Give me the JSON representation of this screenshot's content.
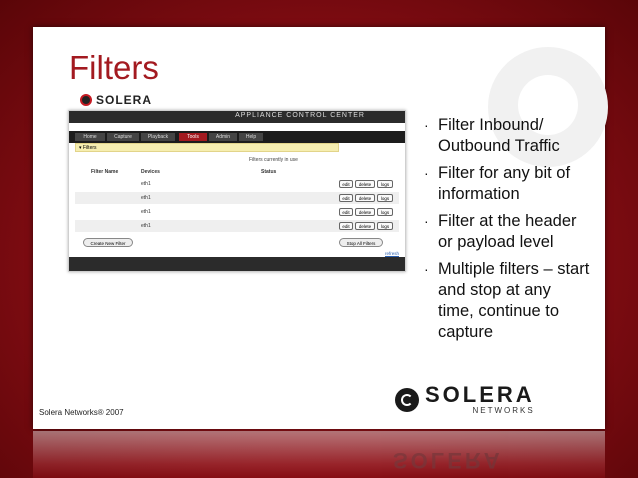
{
  "slide": {
    "title": "Filters",
    "footer": "Solera Networks® 2007",
    "logo_text": "SOLERA",
    "logo_subtext": "NETWORKS",
    "bullets": [
      "Filter Inbound/ Outbound Traffic",
      "Filter for any bit of information",
      "Filter at the header or payload level",
      "Multiple filters – start and stop at any time, continue to capture"
    ],
    "bullet_glyph": "·"
  },
  "screenshot": {
    "app_title": "APPLIANCE CONTROL CENTER",
    "nav_tabs": [
      "Home",
      "Capture",
      "Playback",
      "Tools",
      "Admin",
      "Help"
    ],
    "active_tab": "Tools",
    "breadcrumb": "Filters",
    "summary": "Filters currently in use",
    "columns": [
      "Filter Name",
      "Devices",
      "Status"
    ],
    "rows": [
      {
        "name": "",
        "device": "eth1"
      },
      {
        "name": "",
        "device": "eth1"
      },
      {
        "name": "",
        "device": "eth1"
      },
      {
        "name": "",
        "device": "eth1"
      }
    ],
    "row_buttons": [
      "edit",
      "delete",
      "logs"
    ],
    "create_button": "Create New Filter",
    "stop_button": "Stop All Filters",
    "refresh_link": "refresh"
  },
  "colors": {
    "title": "#a31a20",
    "accent": "#a31a20",
    "background": "#8e0f16"
  }
}
